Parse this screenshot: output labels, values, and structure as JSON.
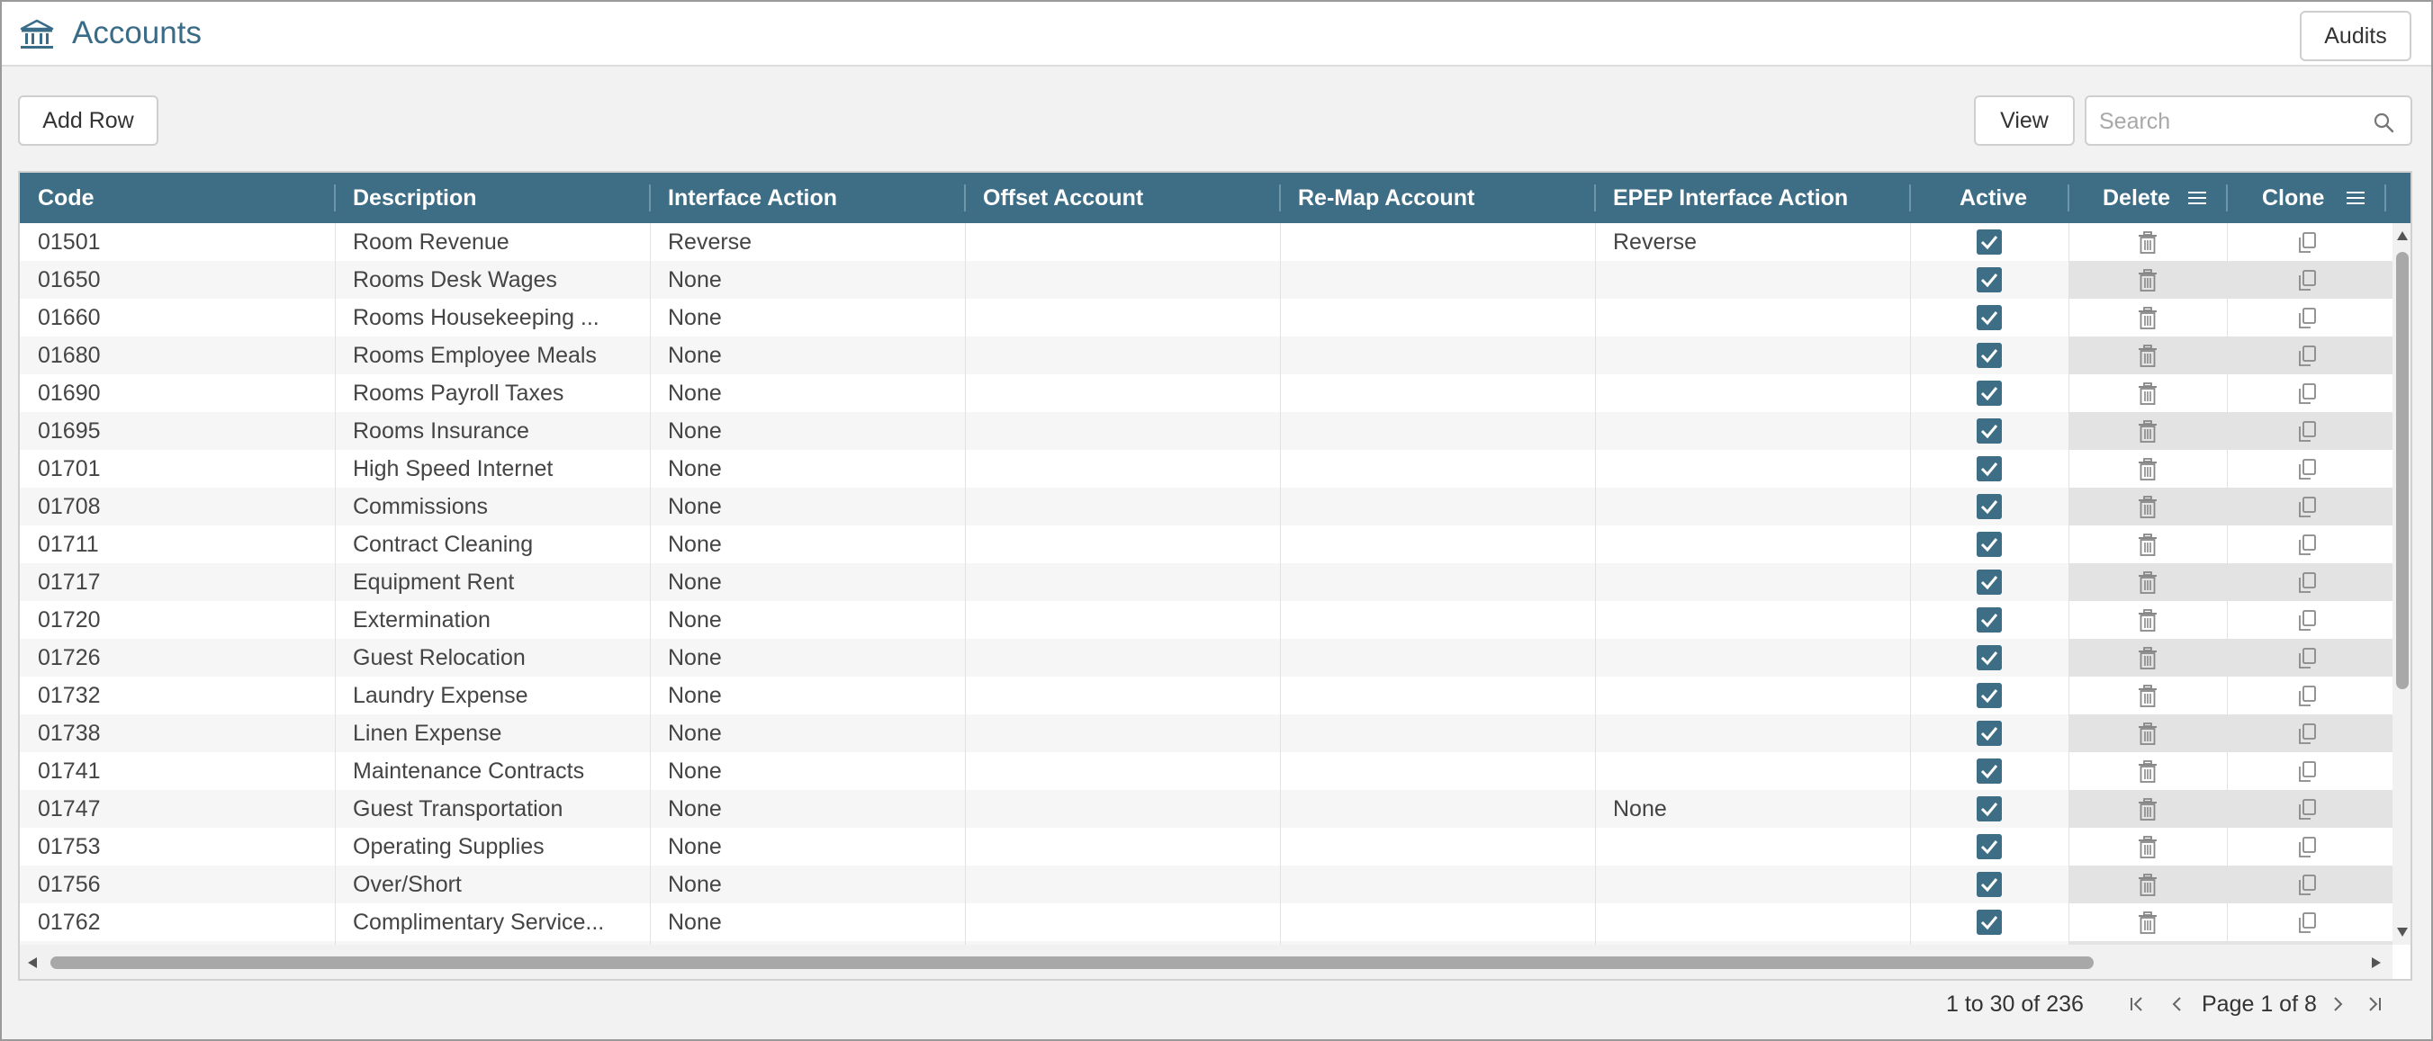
{
  "header": {
    "title": "Accounts",
    "audits_label": "Audits",
    "icon": "bank-icon"
  },
  "toolbar": {
    "add_row_label": "Add Row",
    "view_label": "View",
    "search_placeholder": "Search"
  },
  "columns": [
    "Code",
    "Description",
    "Interface Action",
    "Offset Account",
    "Re-Map Account",
    "EPEP Interface Action",
    "Active",
    "Delete",
    "Clone"
  ],
  "rows": [
    {
      "code": "01501",
      "description": "Room Revenue",
      "interface_action": "Reverse",
      "offset_account": "",
      "remap_account": "",
      "epep_interface_action": "Reverse",
      "active": true
    },
    {
      "code": "01650",
      "description": "Rooms Desk Wages",
      "interface_action": "None",
      "offset_account": "",
      "remap_account": "",
      "epep_interface_action": "",
      "active": true
    },
    {
      "code": "01660",
      "description": "Rooms Housekeeping ...",
      "interface_action": "None",
      "offset_account": "",
      "remap_account": "",
      "epep_interface_action": "",
      "active": true
    },
    {
      "code": "01680",
      "description": "Rooms Employee Meals",
      "interface_action": "None",
      "offset_account": "",
      "remap_account": "",
      "epep_interface_action": "",
      "active": true
    },
    {
      "code": "01690",
      "description": "Rooms Payroll Taxes",
      "interface_action": "None",
      "offset_account": "",
      "remap_account": "",
      "epep_interface_action": "",
      "active": true
    },
    {
      "code": "01695",
      "description": "Rooms Insurance",
      "interface_action": "None",
      "offset_account": "",
      "remap_account": "",
      "epep_interface_action": "",
      "active": true
    },
    {
      "code": "01701",
      "description": "High Speed Internet",
      "interface_action": "None",
      "offset_account": "",
      "remap_account": "",
      "epep_interface_action": "",
      "active": true
    },
    {
      "code": "01708",
      "description": "Commissions",
      "interface_action": "None",
      "offset_account": "",
      "remap_account": "",
      "epep_interface_action": "",
      "active": true
    },
    {
      "code": "01711",
      "description": "Contract Cleaning",
      "interface_action": "None",
      "offset_account": "",
      "remap_account": "",
      "epep_interface_action": "",
      "active": true
    },
    {
      "code": "01717",
      "description": "Equipment Rent",
      "interface_action": "None",
      "offset_account": "",
      "remap_account": "",
      "epep_interface_action": "",
      "active": true
    },
    {
      "code": "01720",
      "description": "Extermination",
      "interface_action": "None",
      "offset_account": "",
      "remap_account": "",
      "epep_interface_action": "",
      "active": true
    },
    {
      "code": "01726",
      "description": "Guest Relocation",
      "interface_action": "None",
      "offset_account": "",
      "remap_account": "",
      "epep_interface_action": "",
      "active": true
    },
    {
      "code": "01732",
      "description": "Laundry Expense",
      "interface_action": "None",
      "offset_account": "",
      "remap_account": "",
      "epep_interface_action": "",
      "active": true
    },
    {
      "code": "01738",
      "description": "Linen Expense",
      "interface_action": "None",
      "offset_account": "",
      "remap_account": "",
      "epep_interface_action": "",
      "active": true
    },
    {
      "code": "01741",
      "description": "Maintenance Contracts",
      "interface_action": "None",
      "offset_account": "",
      "remap_account": "",
      "epep_interface_action": "",
      "active": true
    },
    {
      "code": "01747",
      "description": "Guest Transportation",
      "interface_action": "None",
      "offset_account": "",
      "remap_account": "",
      "epep_interface_action": "None",
      "active": true
    },
    {
      "code": "01753",
      "description": "Operating Supplies",
      "interface_action": "None",
      "offset_account": "",
      "remap_account": "",
      "epep_interface_action": "",
      "active": true
    },
    {
      "code": "01756",
      "description": "Over/Short",
      "interface_action": "None",
      "offset_account": "",
      "remap_account": "",
      "epep_interface_action": "",
      "active": true
    },
    {
      "code": "01762",
      "description": "Complimentary Service...",
      "interface_action": "None",
      "offset_account": "",
      "remap_account": "",
      "epep_interface_action": "",
      "active": true
    },
    {
      "code": "",
      "description": "",
      "interface_action": "",
      "offset_account": "",
      "remap_account": "",
      "epep_interface_action": "",
      "active": true
    }
  ],
  "pager": {
    "range_text": "1 to 30 of 236",
    "page_text": "Page 1 of 8"
  },
  "colors": {
    "header_bg": "#3e6e86",
    "title": "#3b6c87",
    "checkbox": "#3e6e86"
  }
}
